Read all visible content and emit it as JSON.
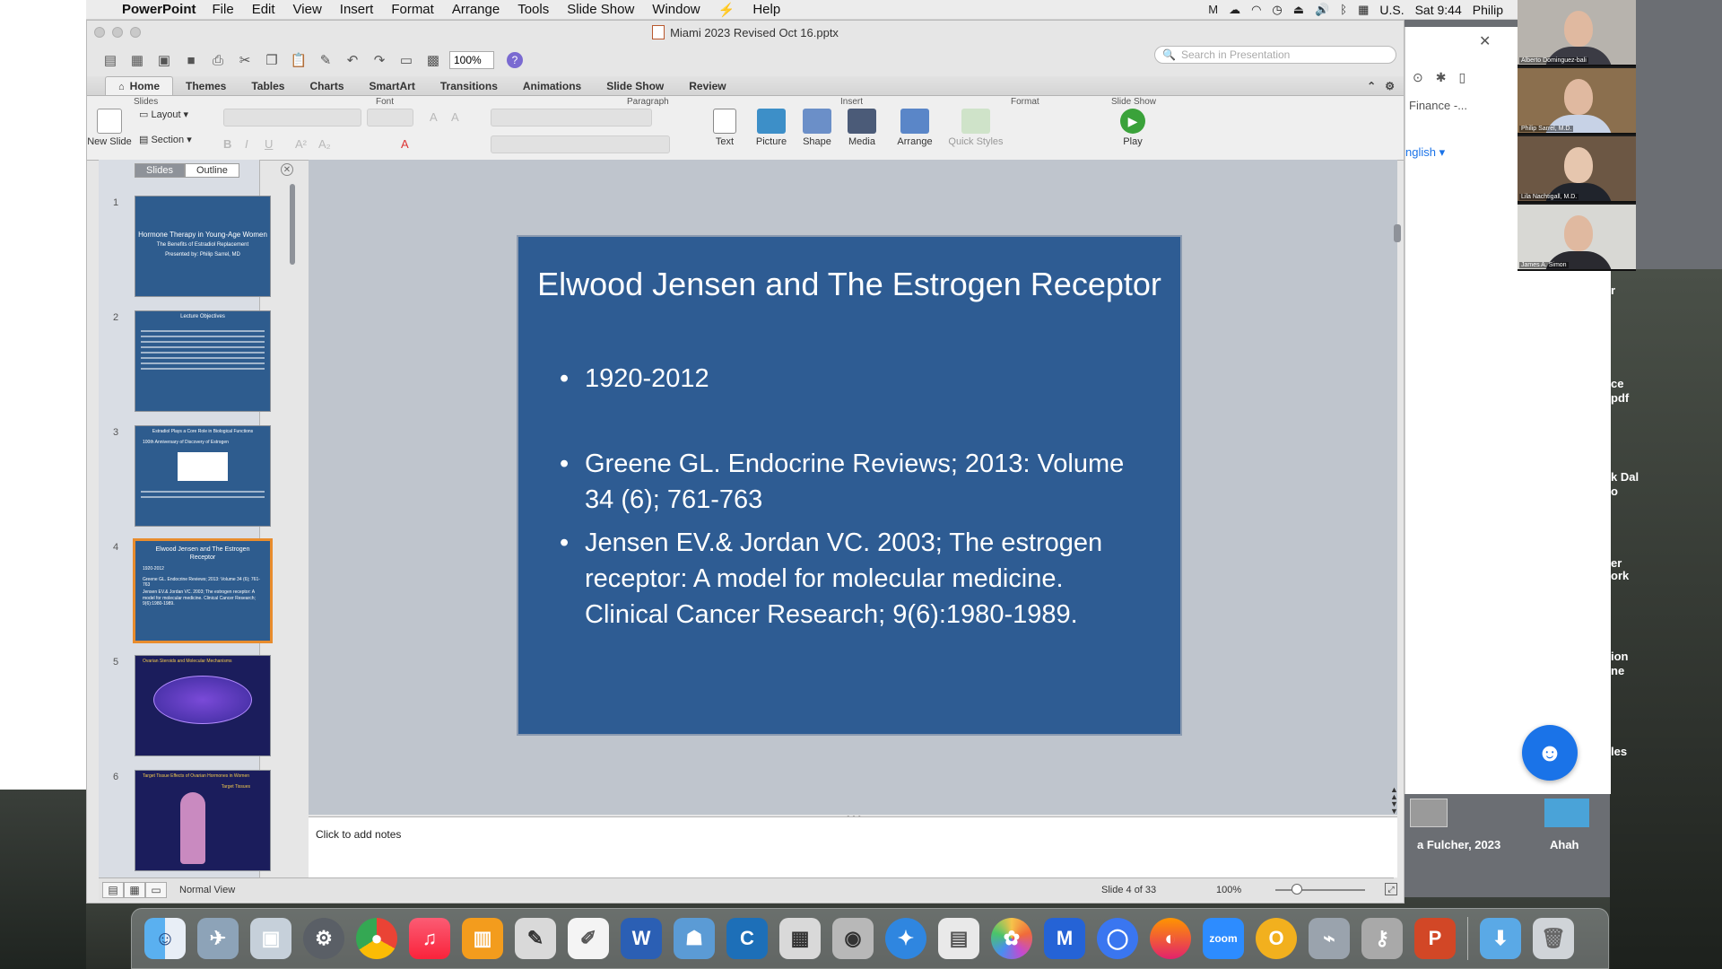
{
  "menubar": {
    "app_name": "PowerPoint",
    "items": [
      "File",
      "Edit",
      "View",
      "Insert",
      "Format",
      "Arrange",
      "Tools",
      "Slide Show",
      "Window",
      "Help"
    ],
    "input_source": "U.S.",
    "clock": "Sat 9:44",
    "user": "Philip"
  },
  "window": {
    "document_title": "Miami 2023 Revised Oct 16.pptx",
    "zoom": "100%",
    "search_placeholder": "Search in Presentation"
  },
  "ribbon": {
    "tabs": [
      "Home",
      "Themes",
      "Tables",
      "Charts",
      "SmartArt",
      "Transitions",
      "Animations",
      "Slide Show",
      "Review"
    ],
    "active_tab": "Home",
    "groups": {
      "slides": "Slides",
      "font": "Font",
      "paragraph": "Paragraph",
      "insert": "Insert",
      "format": "Format",
      "slide_show": "Slide Show"
    },
    "buttons": {
      "new_slide": "New Slide",
      "layout": "Layout",
      "section": "Section",
      "text": "Text",
      "picture": "Picture",
      "shape": "Shape",
      "media": "Media",
      "arrange": "Arrange",
      "quick_styles": "Quick Styles",
      "play": "Play"
    }
  },
  "slides_pane": {
    "tab_slides": "Slides",
    "tab_outline": "Outline",
    "thumbnails": [
      {
        "num": "1",
        "title": "Hormone Therapy in Young-Age Women",
        "subtitle": "The Benefits of Estradiol Replacement",
        "presenter": "Presented by: Philip Sarrel, MD"
      },
      {
        "num": "2",
        "title": "Lecture Objectives"
      },
      {
        "num": "3",
        "title": "Estradiol Plays a Core Role in Biological Functions",
        "subtitle": "100th Anniversary of Discovery of Estrogen"
      },
      {
        "num": "4",
        "title": "Elwood Jensen and The Estrogen Receptor",
        "b1": "1920-2012",
        "b2": "Greene GL. Endocrine Reviews; 2013: Volume 34 (6); 761-763",
        "b3": "Jensen EV.& Jordan VC. 2003; The estrogen receptor: A model for molecular medicine. Clinical Cancer Research; 9(6):1980-1989."
      },
      {
        "num": "5",
        "title": "Ovarian Steroids and Molecular Mechanisms"
      },
      {
        "num": "6",
        "title": "Target Tissue Effects of Ovarian Hormones in Women",
        "subtitle": "Target Tissues"
      }
    ]
  },
  "current_slide": {
    "title": "Elwood Jensen and The Estrogen Receptor",
    "bullets": [
      "1920-2012",
      "Greene GL. Endocrine Reviews; 2013: Volume 34 (6); 761-763",
      "Jensen EV.& Jordan VC. 2003; The estrogen receptor: A model for molecular medicine. Clinical Cancer Research; 9(6):1980-1989."
    ]
  },
  "notes": {
    "placeholder": "Click to add notes"
  },
  "statusbar": {
    "view": "Normal View",
    "slide_counter": "Slide 4 of 33",
    "zoom": "100%"
  },
  "browser": {
    "finance": "Finance -...",
    "language": "nglish"
  },
  "desktop": {
    "label_1": "a Fulcher, 2023",
    "label_2": "Ahah",
    "edge_text": [
      "r",
      "ce",
      "pdf",
      "k Dal",
      "o",
      "er",
      "ork",
      "ion",
      "ne",
      "les"
    ]
  },
  "zoom_participants": [
    {
      "name": "Alberto Dominguez-bali"
    },
    {
      "name": "Philip Sarrel, M.D."
    },
    {
      "name": "Lila Nachtigall, M.D."
    },
    {
      "name": "James A. Simon"
    }
  ],
  "dock": {
    "items": [
      "finder",
      "launchpad",
      "preview",
      "system-preferences",
      "chrome",
      "music",
      "books",
      "script-editor",
      "textedit",
      "word",
      "teams",
      "c-app",
      "calculator",
      "photo-booth",
      "safari",
      "calendar-preview",
      "photos",
      "mail",
      "signal",
      "firefox",
      "zoom",
      "o-app",
      "network-utility",
      "keychain",
      "powerpoint",
      "downloads",
      "trash"
    ],
    "zoom_label": "zoom"
  }
}
